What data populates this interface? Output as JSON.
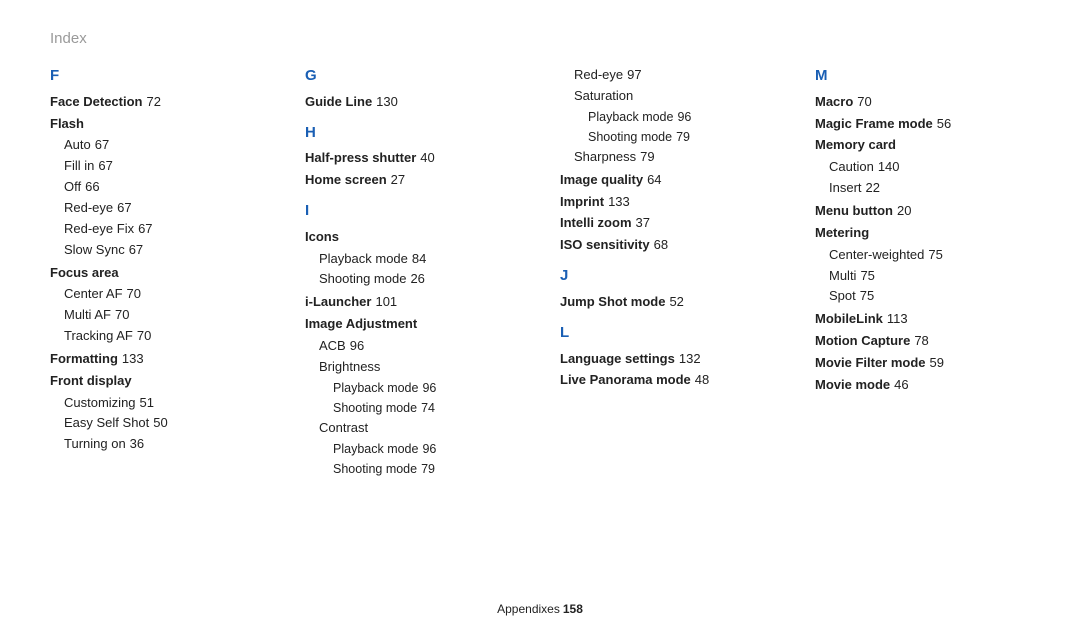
{
  "header": "Index",
  "footer": {
    "section": "Appendixes",
    "page": "158"
  },
  "col1": {
    "F": "F",
    "face_detection": {
      "label": "Face Detection",
      "pg": "72"
    },
    "flash": {
      "label": "Flash",
      "subs": {
        "auto": {
          "label": "Auto",
          "pg": "67"
        },
        "fillin": {
          "label": "Fill in",
          "pg": "67"
        },
        "off": {
          "label": "Off",
          "pg": "66"
        },
        "redeye": {
          "label": "Red-eye",
          "pg": "67"
        },
        "redeyefix": {
          "label": "Red-eye Fix",
          "pg": "67"
        },
        "slowsync": {
          "label": "Slow Sync",
          "pg": "67"
        }
      }
    },
    "focus_area": {
      "label": "Focus area",
      "subs": {
        "centeraf": {
          "label": "Center AF",
          "pg": "70"
        },
        "multiaf": {
          "label": "Multi AF",
          "pg": "70"
        },
        "trackingaf": {
          "label": "Tracking AF",
          "pg": "70"
        }
      }
    },
    "formatting": {
      "label": "Formatting",
      "pg": "133"
    },
    "front_display": {
      "label": "Front display",
      "subs": {
        "customizing": {
          "label": "Customizing",
          "pg": "51"
        },
        "easyselfshot": {
          "label": "Easy Self Shot",
          "pg": "50"
        },
        "turningon": {
          "label": "Turning on",
          "pg": "36"
        }
      }
    }
  },
  "col2": {
    "G": "G",
    "guideline": {
      "label": "Guide Line",
      "pg": "130"
    },
    "H": "H",
    "halfpress": {
      "label": "Half-press shutter",
      "pg": "40"
    },
    "homescreen": {
      "label": "Home screen",
      "pg": "27"
    },
    "I": "I",
    "icons": {
      "label": "Icons",
      "subs": {
        "playback": {
          "label": "Playback mode",
          "pg": "84"
        },
        "shooting": {
          "label": "Shooting mode",
          "pg": "26"
        }
      }
    },
    "ilauncher": {
      "label": "i-Launcher",
      "pg": "101"
    },
    "imageadj": {
      "label": "Image Adjustment",
      "subs": {
        "acb": {
          "label": "ACB",
          "pg": "96"
        },
        "brightness": {
          "label": "Brightness",
          "subs": {
            "playback": {
              "label": "Playback mode",
              "pg": "96"
            },
            "shooting": {
              "label": "Shooting mode",
              "pg": "74"
            }
          }
        },
        "contrast": {
          "label": "Contrast",
          "subs": {
            "playback": {
              "label": "Playback mode",
              "pg": "96"
            },
            "shooting": {
              "label": "Shooting mode",
              "pg": "79"
            }
          }
        }
      }
    }
  },
  "col3": {
    "imageadj_cont": {
      "redeye": {
        "label": "Red-eye",
        "pg": "97"
      },
      "saturation": {
        "label": "Saturation",
        "subs": {
          "playback": {
            "label": "Playback mode",
            "pg": "96"
          },
          "shooting": {
            "label": "Shooting mode",
            "pg": "79"
          }
        }
      },
      "sharpness": {
        "label": "Sharpness",
        "pg": "79"
      }
    },
    "imagequality": {
      "label": "Image quality",
      "pg": "64"
    },
    "imprint": {
      "label": "Imprint",
      "pg": "133"
    },
    "intellizoom": {
      "label": "Intelli zoom",
      "pg": "37"
    },
    "iso": {
      "label": "ISO sensitivity",
      "pg": "68"
    },
    "J": "J",
    "jumpshot": {
      "label": "Jump Shot mode",
      "pg": "52"
    },
    "L": "L",
    "language": {
      "label": "Language settings",
      "pg": "132"
    },
    "livepano": {
      "label": "Live Panorama mode",
      "pg": "48"
    }
  },
  "col4": {
    "M": "M",
    "macro": {
      "label": "Macro",
      "pg": "70"
    },
    "magicframe": {
      "label": "Magic Frame mode",
      "pg": "56"
    },
    "memorycard": {
      "label": "Memory card",
      "subs": {
        "caution": {
          "label": "Caution",
          "pg": "140"
        },
        "insert": {
          "label": "Insert",
          "pg": "22"
        }
      }
    },
    "menubutton": {
      "label": "Menu button",
      "pg": "20"
    },
    "metering": {
      "label": "Metering",
      "subs": {
        "centerweighted": {
          "label": "Center-weighted",
          "pg": "75"
        },
        "multi": {
          "label": "Multi",
          "pg": "75"
        },
        "spot": {
          "label": "Spot",
          "pg": "75"
        }
      }
    },
    "mobilelink": {
      "label": "MobileLink",
      "pg": "113"
    },
    "motioncapture": {
      "label": "Motion Capture",
      "pg": "78"
    },
    "moviefilter": {
      "label": "Movie Filter mode",
      "pg": "59"
    },
    "moviemode": {
      "label": "Movie mode",
      "pg": "46"
    }
  }
}
